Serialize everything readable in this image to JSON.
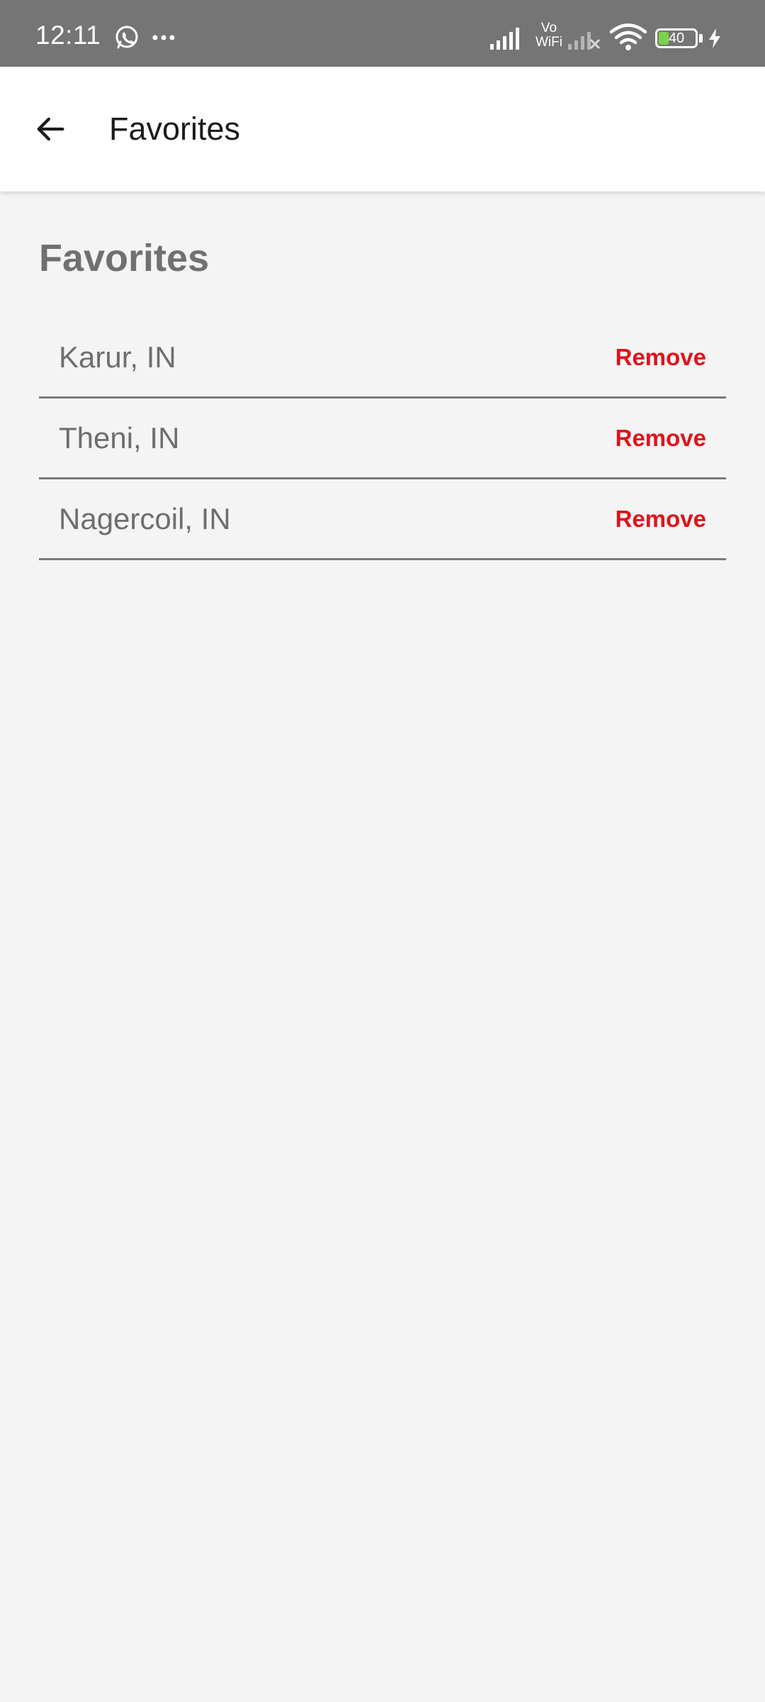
{
  "status_bar": {
    "time": "12:11",
    "notification_icons": [
      "whatsapp-icon",
      "more-dots-icon"
    ],
    "network_label": "Vo\nWiFi",
    "battery_level": "40",
    "battery_color": "#7ed14a"
  },
  "app_bar": {
    "back_icon": "arrow-back-icon",
    "title": "Favorites"
  },
  "main": {
    "heading": "Favorites",
    "favorites": [
      {
        "name": "Karur, IN",
        "action": "Remove"
      },
      {
        "name": "Theni, IN",
        "action": "Remove"
      },
      {
        "name": "Nagercoil, IN",
        "action": "Remove"
      }
    ]
  },
  "colors": {
    "status_bar_bg": "#757575",
    "background": "#f4f4f4",
    "remove_accent": "#e0131b",
    "text_muted": "#6e6e6e"
  }
}
